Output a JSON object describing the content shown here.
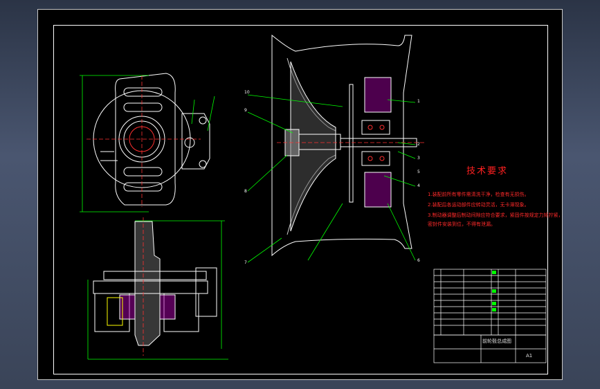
{
  "technical_requirements": {
    "title": "技术要求",
    "lines": [
      "1.装配前所有零件需清洗干净，检查有无损伤。",
      "2.装配后各运动部件应转动灵活，无卡滞现象。",
      "3.制动器调整后制动间隙应符合要求，紧固件按规定力矩拧紧，",
      "  密封件安装到位，不得有泄漏。"
    ]
  },
  "title_block": {
    "drawing_title": "前轮毂总成图",
    "sheet": "A1"
  },
  "balloon_numbers_left": [
    "10",
    "9",
    "8",
    "7"
  ],
  "balloon_numbers_right": [
    "1",
    "2",
    "3",
    "4",
    "5",
    "6"
  ],
  "colors": {
    "outline": "#ffffff",
    "dimension": "#00ff00",
    "centerline": "#ff3030",
    "hatch": "#c0c0c0",
    "bearing": "#ff00ff",
    "accent": "#ffff00"
  }
}
